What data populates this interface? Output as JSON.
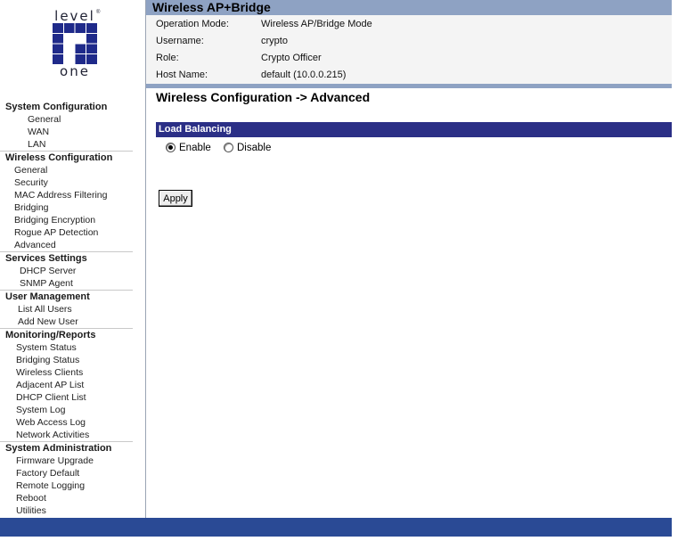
{
  "logo": {
    "top_word": "level",
    "bottom_word": "one",
    "trademark": "®"
  },
  "header": {
    "title": "Wireless AP+Bridge",
    "info": [
      {
        "label": "Operation Mode:",
        "value": "Wireless AP/Bridge Mode"
      },
      {
        "label": "Username:",
        "value": "crypto"
      },
      {
        "label": "Role:",
        "value": "Crypto Officer"
      },
      {
        "label": "Host Name:",
        "value": "default (10.0.0.215)"
      }
    ]
  },
  "nav": {
    "groups": [
      {
        "title": "System Configuration",
        "items": [
          "General",
          "WAN",
          "LAN"
        ]
      },
      {
        "title": "Wireless Configuration",
        "items": [
          "General",
          "Security",
          "MAC Address Filtering",
          "Bridging",
          "Bridging Encryption",
          "Rogue AP Detection",
          "Advanced"
        ]
      },
      {
        "title": "Services Settings",
        "items": [
          "DHCP Server",
          "SNMP Agent"
        ]
      },
      {
        "title": "User Management",
        "items": [
          "List All Users",
          "Add New User"
        ]
      },
      {
        "title": "Monitoring/Reports",
        "items": [
          "System Status",
          "Bridging Status",
          "Wireless Clients",
          "Adjacent AP List",
          "DHCP Client List",
          "System Log",
          "Web Access Log",
          "Network Activities"
        ]
      },
      {
        "title": "System Administration",
        "items": [
          "Firmware Upgrade",
          "Factory Default",
          "Remote Logging",
          "Reboot",
          "Utilities"
        ]
      }
    ]
  },
  "main": {
    "heading": "Wireless Configuration -> Advanced",
    "section": {
      "title": "Load Balancing",
      "options": [
        {
          "label": "Enable",
          "selected": true
        },
        {
          "label": "Disable",
          "selected": false
        }
      ]
    },
    "apply_label": "Apply"
  },
  "colors": {
    "header_bar": "#8ea2c3",
    "section_bar": "#2b2f86",
    "footer_bar": "#2a4a95",
    "info_panel": "#f4f4f4"
  },
  "icons": {
    "logo": "levelone-logo-icon",
    "radio": "radio-button-icon"
  }
}
